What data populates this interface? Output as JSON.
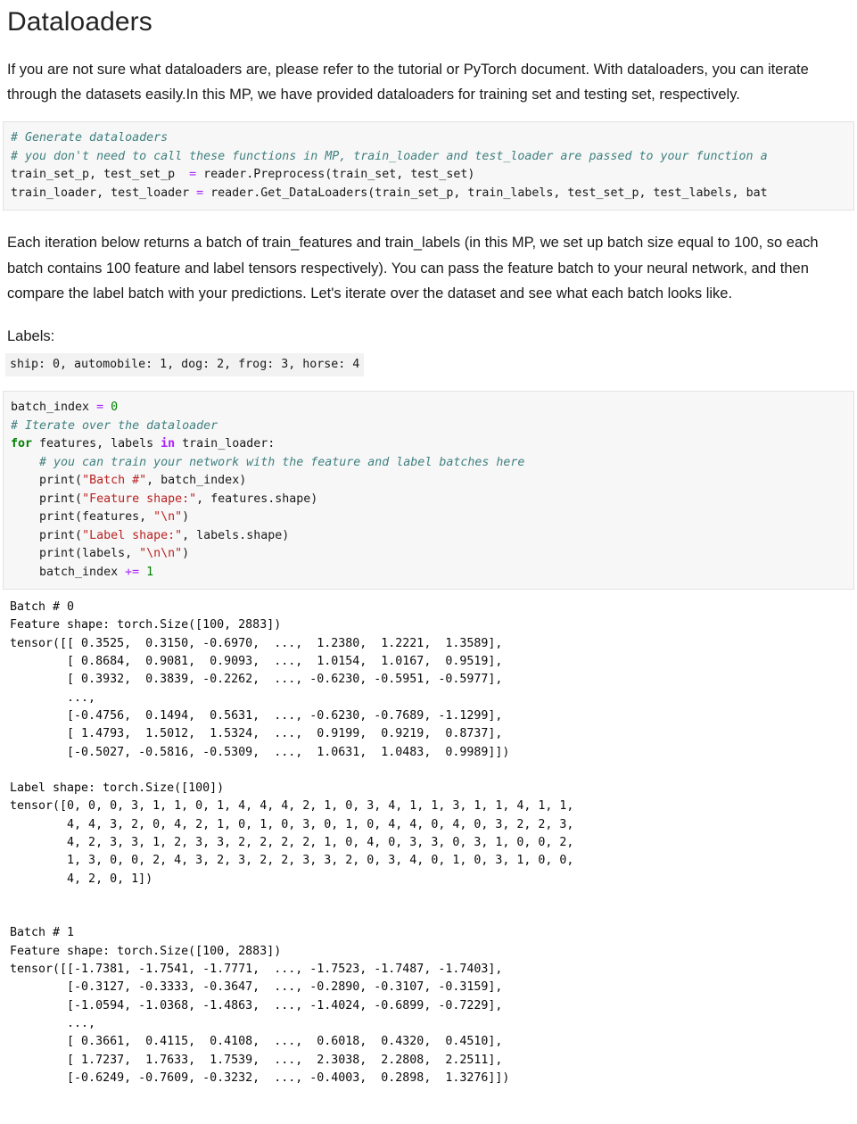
{
  "page": {
    "title": "Dataloaders"
  },
  "paragraphs": {
    "intro": "If you are not sure what dataloaders are, please refer to the tutorial or PyTorch document. With dataloaders, you can iterate through the datasets easily.In this MP, we have provided dataloaders for training set and testing set, respectively.",
    "iteration": "Each iteration below returns a batch of train_features and train_labels (in this MP, we set up batch size equal to 100, so each batch contains 100 feature and label tensors respectively). You can pass the feature batch to your neural network, and then compare the label batch with your predictions. Let's iterate over the dataset and see what each batch looks like.",
    "labels_heading": "Labels:"
  },
  "inline_code": {
    "labels_map": "ship: 0, automobile: 1, dog: 2, frog: 3, horse: 4"
  },
  "code_cell_1": {
    "comment_1": "# Generate dataloaders",
    "comment_2": "# you don't need to call these functions in MP, train_loader and test_loader are passed to your function a",
    "line_3_a": "train_set_p, test_set_p  ",
    "line_3_op": "=",
    "line_3_b": " reader.Preprocess(train_set, test_set)",
    "line_4_a": "train_loader, test_loader ",
    "line_4_op": "=",
    "line_4_b": " reader.Get_DataLoaders(train_set_p, train_labels, test_set_p, test_labels, bat"
  },
  "code_cell_2": {
    "l1_name": "batch_index ",
    "l1_op": "=",
    "l1_num": " 0",
    "l2_comment": "# Iterate over the dataloader",
    "l3_kw_for": "for",
    "l3_mid": " features, labels ",
    "l3_kw_in": "in",
    "l3_tail": " train_loader:",
    "l4_comment": "    # you can train your network with the feature and label batches here",
    "l5_a": "    print(",
    "l5_str": "\"Batch #\"",
    "l5_b": ", batch_index)",
    "l6_a": "    print(",
    "l6_str": "\"Feature shape:\"",
    "l6_b": ", features.shape)",
    "l7_a": "    print(features, ",
    "l7_str": "\"\\n\"",
    "l7_b": ")",
    "l8_a": "    print(",
    "l8_str": "\"Label shape:\"",
    "l8_b": ", labels.shape)",
    "l9_a": "    print(labels, ",
    "l9_str": "\"\\n\\n\"",
    "l9_b": ")",
    "l10_a": "    batch_index ",
    "l10_op": "+=",
    "l10_num": " 1"
  },
  "output": {
    "batch_0": {
      "header": "Batch # 0",
      "feature_shape": "Feature shape: torch.Size([100, 2883])",
      "feature_tensor": [
        "tensor([[ 0.3525,  0.3150, -0.6970,  ...,  1.2380,  1.2221,  1.3589],",
        "        [ 0.8684,  0.9081,  0.9093,  ...,  1.0154,  1.0167,  0.9519],",
        "        [ 0.3932,  0.3839, -0.2262,  ..., -0.6230, -0.5951, -0.5977],",
        "        ...,",
        "        [-0.4756,  0.1494,  0.5631,  ..., -0.6230, -0.7689, -1.1299],",
        "        [ 1.4793,  1.5012,  1.5324,  ...,  0.9199,  0.9219,  0.8737],",
        "        [-0.5027, -0.5816, -0.5309,  ...,  1.0631,  1.0483,  0.9989]])"
      ],
      "label_shape": "Label shape: torch.Size([100])",
      "label_tensor": [
        "tensor([0, 0, 0, 3, 1, 1, 0, 1, 4, 4, 4, 2, 1, 0, 3, 4, 1, 1, 3, 1, 1, 4, 1, 1,",
        "        4, 4, 3, 2, 0, 4, 2, 1, 0, 1, 0, 3, 0, 1, 0, 4, 4, 0, 4, 0, 3, 2, 2, 3,",
        "        4, 2, 3, 3, 1, 2, 3, 3, 2, 2, 2, 2, 1, 0, 4, 0, 3, 3, 0, 3, 1, 0, 0, 2,",
        "        1, 3, 0, 0, 2, 4, 3, 2, 3, 2, 2, 3, 3, 2, 0, 3, 4, 0, 1, 0, 3, 1, 0, 0,",
        "        4, 2, 0, 1])"
      ]
    },
    "batch_1": {
      "header": "Batch # 1",
      "feature_shape": "Feature shape: torch.Size([100, 2883])",
      "feature_tensor": [
        "tensor([[-1.7381, -1.7541, -1.7771,  ..., -1.7523, -1.7487, -1.7403],",
        "        [-0.3127, -0.3333, -0.3647,  ..., -0.2890, -0.3107, -0.3159],",
        "        [-1.0594, -1.0368, -1.4863,  ..., -1.4024, -0.6899, -0.7229],",
        "        ...,",
        "        [ 0.3661,  0.4115,  0.4108,  ...,  0.6018,  0.4320,  0.4510],",
        "        [ 1.7237,  1.7633,  1.7539,  ...,  2.3038,  2.2808,  2.2511],",
        "        [-0.6249, -0.7609, -0.3232,  ..., -0.4003,  0.2898,  1.3276]])"
      ]
    }
  },
  "colors": {
    "code_background": "#f7f7f7",
    "code_border": "#e3e3e3",
    "comment": "#408080",
    "keyword": "#008000",
    "operator": "#aa22ff",
    "string": "#ba2121",
    "number": "#008000",
    "heading": "#252525"
  }
}
